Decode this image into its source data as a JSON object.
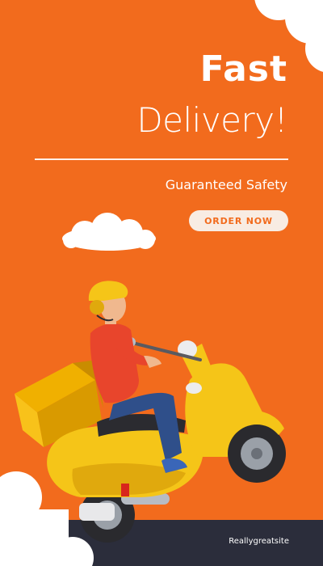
{
  "headline": {
    "line1": "Fast",
    "line2": "Delivery!"
  },
  "subtitle": "Guaranteed Safety",
  "cta": {
    "label": "ORDER NOW"
  },
  "footer": {
    "site": "Reallygreatsite"
  },
  "colors": {
    "background": "#f26b1d",
    "footer_bar": "#2b2d3b",
    "cta_bg": "#f8ece3",
    "scooter": "#f5c518",
    "shirt": "#e8452c"
  },
  "illustration": "delivery-rider-on-yellow-scooter"
}
